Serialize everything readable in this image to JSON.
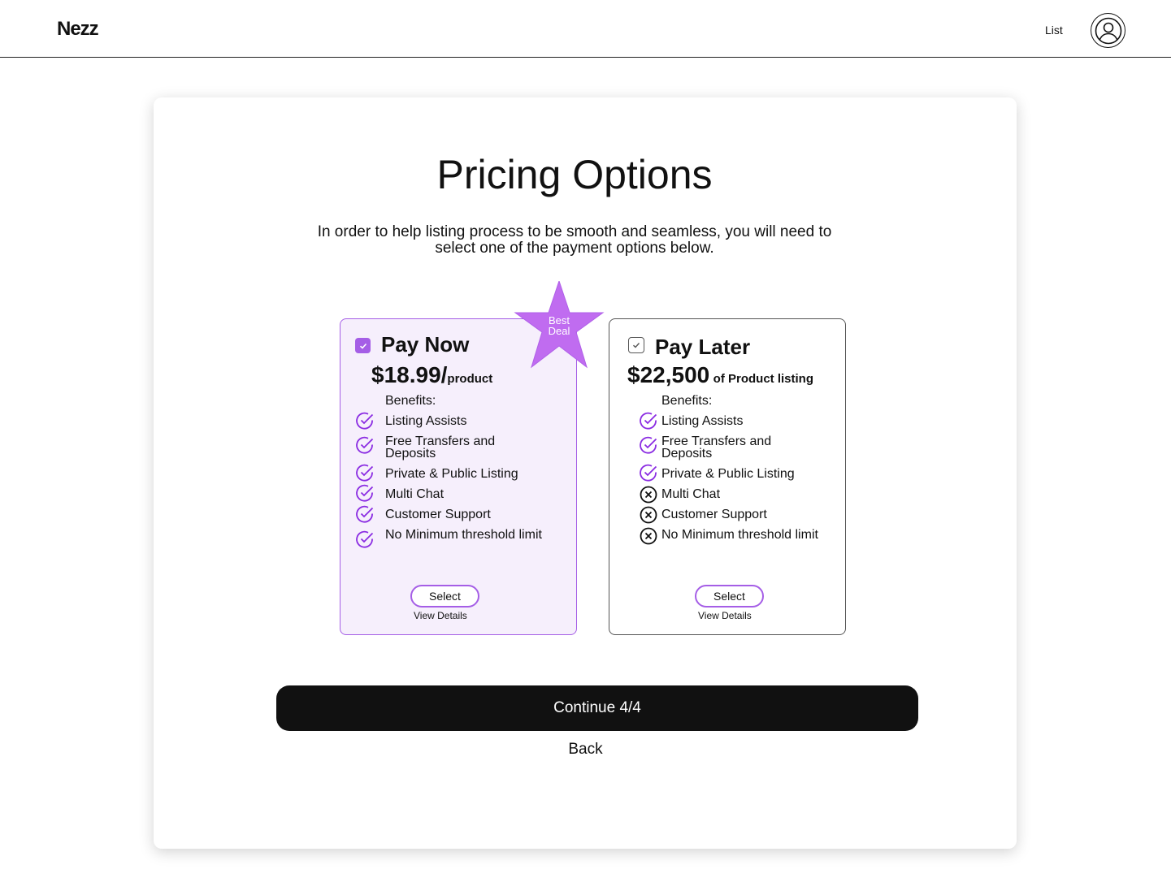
{
  "header": {
    "logo": "Nezz",
    "nav_list": "List",
    "avatar_icon": "user-circle-icon"
  },
  "main": {
    "title": "Pricing Options",
    "subtitle": "In order to help listing process to be smooth and seamless, you will need to select one of the payment options below.",
    "badge": {
      "line1": "Best",
      "line2": "Deal",
      "color": "#c06cf0"
    },
    "plans": [
      {
        "name": "Pay Now",
        "selected": true,
        "price": "$18.99/",
        "price_unit": "product",
        "benefits_label": "Benefits:",
        "benefits": [
          {
            "text": "Listing Assists",
            "included": true
          },
          {
            "text": "Free Transfers and Deposits",
            "included": true
          },
          {
            "text": "Private & Public Listing",
            "included": true
          },
          {
            "text": "Multi Chat",
            "included": true
          },
          {
            "text": "Customer Support",
            "included": true
          },
          {
            "text": "No Minimum threshold limit",
            "included": true
          }
        ],
        "select_label": "Select",
        "details_label": "View Details"
      },
      {
        "name": "Pay Later",
        "selected": false,
        "price": "$22,500",
        "price_unit": "of Product listing",
        "benefits_label": "Benefits:",
        "benefits": [
          {
            "text": "Listing Assists",
            "included": true
          },
          {
            "text": "Free Transfers and Deposits",
            "included": true
          },
          {
            "text": "Private & Public Listing",
            "included": true
          },
          {
            "text": "Multi Chat",
            "included": false
          },
          {
            "text": "Customer Support",
            "included": false
          },
          {
            "text": "No Minimum threshold limit",
            "included": false
          }
        ],
        "select_label": "Select",
        "details_label": "View Details"
      }
    ],
    "continue_label": "Continue 4/4",
    "back_label": "Back"
  },
  "colors": {
    "accent": "#a55ee6",
    "dark": "#111111"
  }
}
